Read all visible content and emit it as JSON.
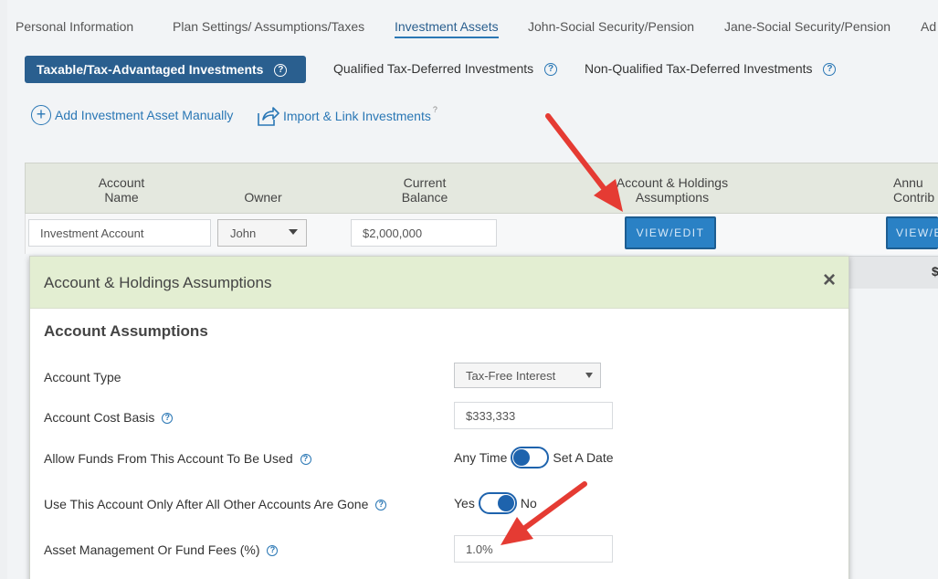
{
  "nav": {
    "tabs": [
      {
        "label": "Personal Information"
      },
      {
        "label": "Plan Settings/ Assumptions/Taxes"
      },
      {
        "label": "Investment Assets"
      },
      {
        "label": "John-Social Security/Pension"
      },
      {
        "label": "Jane-Social Security/Pension"
      },
      {
        "label": "Ad"
      }
    ],
    "active_tab": "Investment Assets"
  },
  "subtabs": {
    "active": "Taxable/Tax-Advantaged Investments",
    "others": [
      "Qualified Tax-Deferred Investments",
      "Non-Qualified Tax-Deferred Investments"
    ]
  },
  "actions": {
    "add_manual": "Add Investment Asset Manually",
    "import_link": "Import & Link Investments",
    "import_help": "?"
  },
  "table": {
    "headers": {
      "account_name": "Account\nName",
      "owner": "Owner",
      "current_balance": "Current\nBalance",
      "assumptions": "Account & Holdings\nAssumptions",
      "annual_contrib": "Annu\nContrib"
    },
    "row": {
      "account_name": "Investment Account",
      "owner": "John",
      "current_balance": "$2,000,000",
      "view_edit": "VIEW/EDIT",
      "view_edit_2": "VIEW/E"
    },
    "total": "$"
  },
  "modal": {
    "title": "Account & Holdings Assumptions",
    "close": "×",
    "section_title": "Account Assumptions",
    "fields": {
      "account_type_label": "Account Type",
      "account_type_value": "Tax-Free Interest",
      "cost_basis_label": "Account Cost Basis",
      "cost_basis_value": "$333,333",
      "allow_funds_label": "Allow Funds From This Account To Be Used",
      "allow_funds_left": "Any Time",
      "allow_funds_right": "Set A Date",
      "use_after_label": "Use This Account Only After All Other Accounts Are Gone",
      "use_after_left": "Yes",
      "use_after_right": "No",
      "fees_label": "Asset Management Or Fund Fees (%)",
      "fees_value": "1.0%"
    }
  },
  "colors": {
    "primary": "#2a5f8f",
    "button": "#2a81c5",
    "toggle": "#1e63ad",
    "modal_header": "#e3eed2",
    "arrow": "#e53b33"
  },
  "help_glyph": "?"
}
